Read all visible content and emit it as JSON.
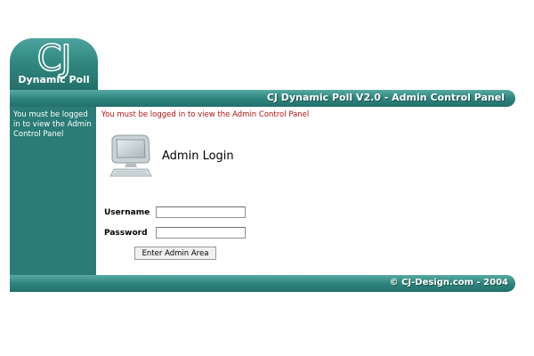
{
  "brand": {
    "logo_mark": "CJ",
    "logo_subtitle": "Dynamic Poll"
  },
  "header": {
    "title": "CJ Dynamic Poll V2.0 - Admin Control Panel"
  },
  "sidebar": {
    "message": "You must be logged in to view the Admin Control Panel"
  },
  "main": {
    "error_message": "You must be logged in to view the Admin Control Panel",
    "icon": "computer-icon",
    "login_title": "Admin Login",
    "username_label": "Username",
    "username_value": "",
    "password_label": "Password",
    "password_value": "",
    "submit_label": "Enter Admin Area"
  },
  "footer": {
    "copyright": "© CJ-Design.com - 2004"
  },
  "colors": {
    "teal_dark": "#2b7c76",
    "teal_light": "#56aaa2",
    "error_red": "#b31212",
    "text_white": "#ffffff"
  }
}
